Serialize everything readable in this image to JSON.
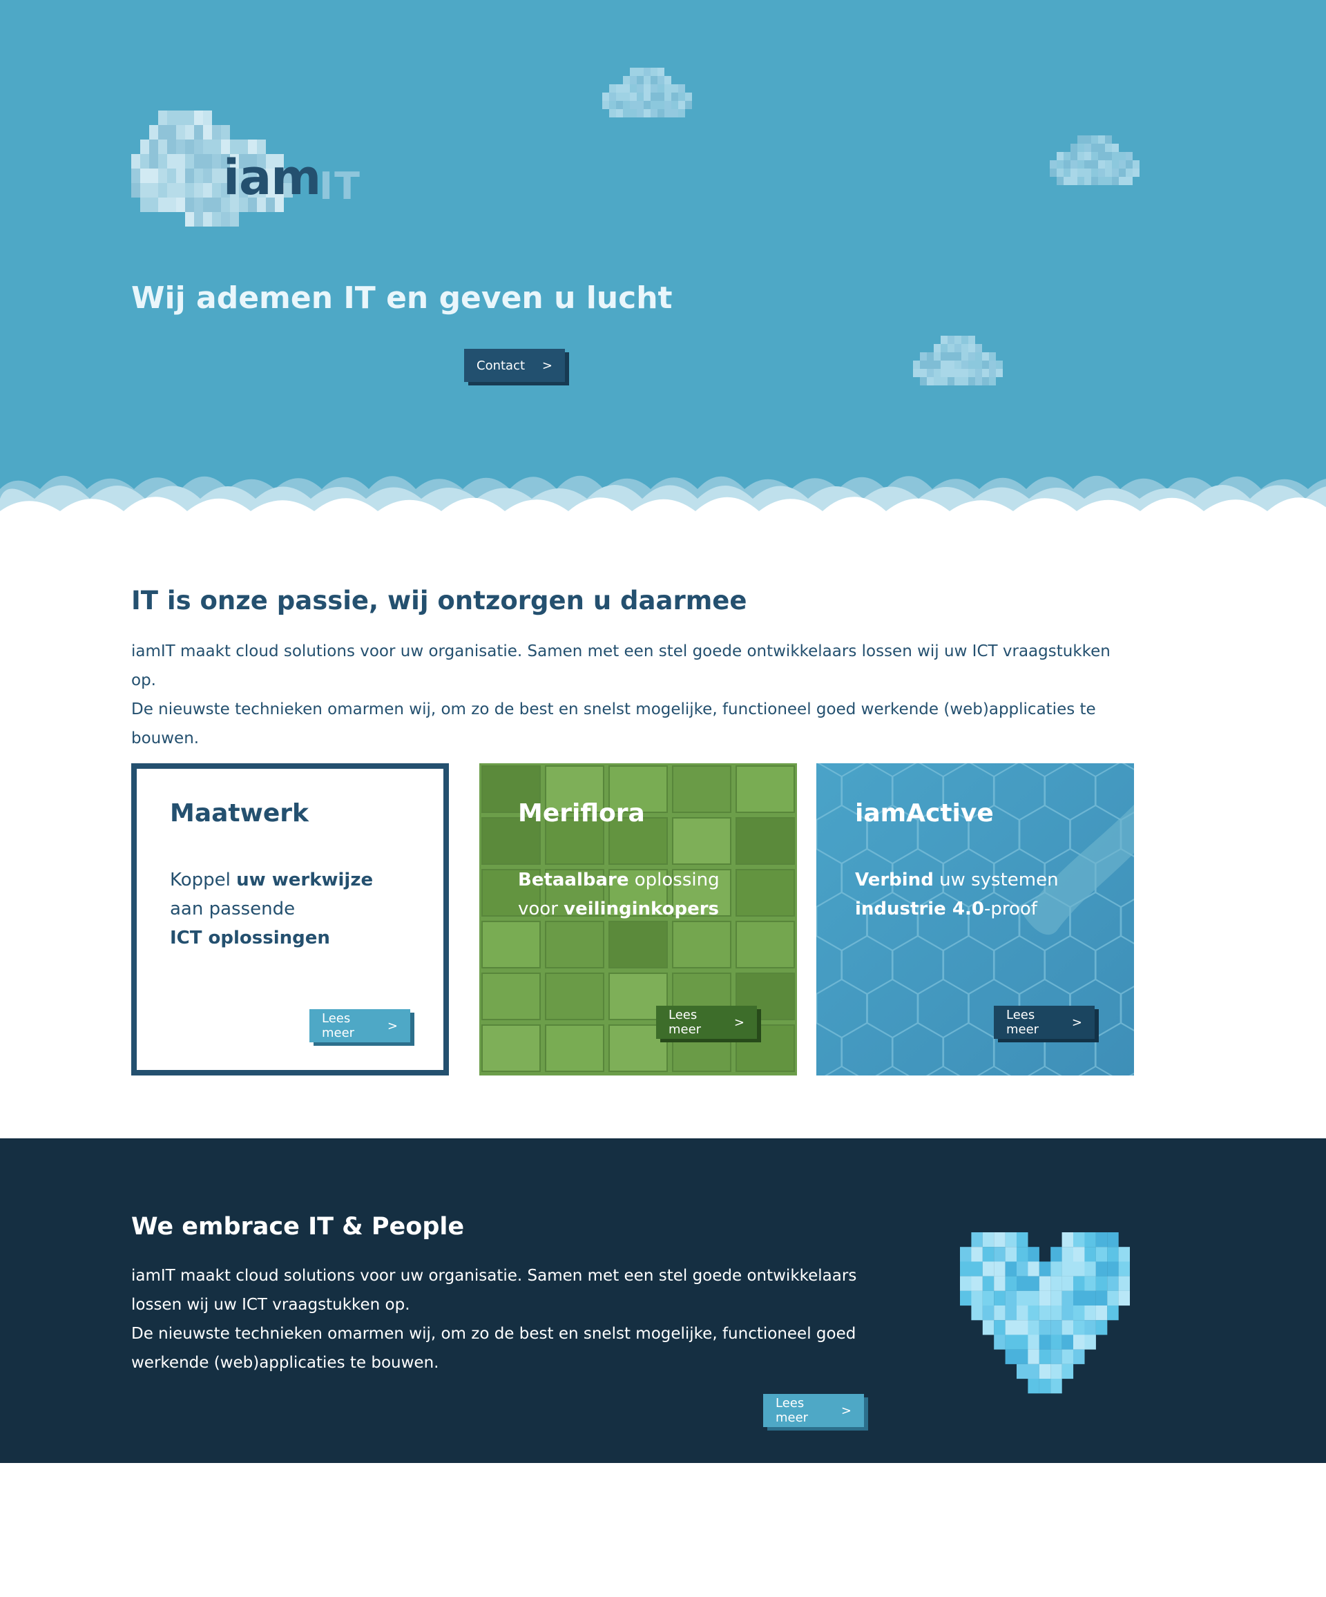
{
  "brand": {
    "logo_main": "iam",
    "logo_accent": "IT"
  },
  "hero": {
    "tagline": "Wij ademen IT en geven u lucht",
    "contact_label": "Contact",
    "arrow": ">"
  },
  "intro": {
    "title": "IT is onze passie, wij ontzorgen u daarmee",
    "paragraph_1": "iamIT maakt cloud solutions voor uw organisatie. Samen met een stel goede ontwikkelaars lossen wij uw ICT vraagstukken op.",
    "paragraph_2": "De nieuwste technieken omarmen wij, om zo de best en snelst mogelijke, functioneel goed werkende (web)applicaties te bouwen."
  },
  "cards": [
    {
      "title": "Maatwerk",
      "line1_plain": "Koppel ",
      "line1_bold": "uw werkwijze",
      "line2_plain": "aan passende",
      "line3_bold": "ICT oplossingen",
      "button": "Lees meer"
    },
    {
      "title": "Meriflora",
      "line1_bold": "Betaalbare",
      "line1_plain": " oplossing",
      "line2_plain": "voor ",
      "line2_bold": "veilinginkopers",
      "button": "Lees meer"
    },
    {
      "title": "iamActive",
      "line1_bold": "Verbind",
      "line1_plain": " uw systemen",
      "line2_bold": "industrie 4.0",
      "line2_plain": "-proof",
      "button": "Lees meer"
    }
  ],
  "embrace": {
    "title": "We embrace IT & People",
    "paragraph_1": "iamIT maakt cloud solutions voor uw organisatie. Samen met een stel goede ontwikkelaars lossen wij uw ICT vraagstukken op.",
    "paragraph_2": "De nieuwste technieken omarmen wij, om zo de best en snelst mogelijke, functioneel goed werkende (web)applicaties te bouwen.",
    "button": "Lees meer"
  },
  "colors": {
    "hero_bg": "#4ea8c6",
    "navy": "#24506f",
    "dark_section": "#152f42",
    "green_card": "#6b9e4a",
    "blue_card": "#4aa1c6"
  },
  "icons": [
    "pixel-cloud-icon",
    "pixel-heart-icon",
    "chevron-right-icon"
  ]
}
